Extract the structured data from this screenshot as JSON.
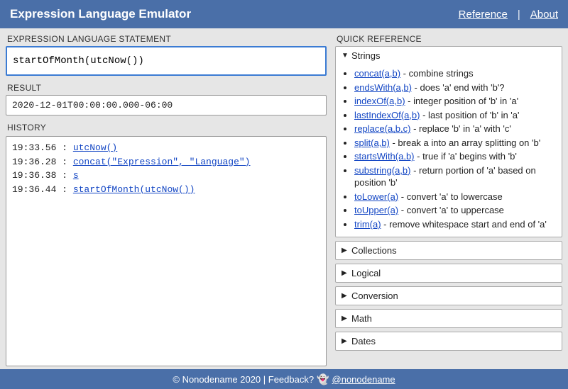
{
  "header": {
    "title": "Expression Language Emulator",
    "reference": "Reference",
    "about": "About"
  },
  "labels": {
    "statement": "EXPRESSION LANGUAGE STATEMENT",
    "result": "RESULT",
    "history": "HISTORY",
    "quickref": "QUICK REFERENCE"
  },
  "statement_value": "startOfMonth(utcNow())",
  "result_value": "2020-12-01T00:00:00.000-06:00",
  "history": [
    {
      "time": "19:33.56",
      "expr": "utcNow()"
    },
    {
      "time": "19:36.28",
      "expr": "concat(\"Expression\", \"Language\")"
    },
    {
      "time": "19:36.38",
      "expr": "s"
    },
    {
      "time": "19:36.44",
      "expr": "startOfMonth(utcNow())"
    }
  ],
  "quickref": {
    "sections": [
      {
        "title": "Strings",
        "open": true,
        "items": [
          {
            "fn": "concat(a,b)",
            "desc": "combine strings"
          },
          {
            "fn": "endsWith(a,b)",
            "desc": "does 'a' end with 'b'?"
          },
          {
            "fn": "indexOf(a,b)",
            "desc": "integer position of 'b' in 'a'"
          },
          {
            "fn": "lastIndexOf(a,b)",
            "desc": "last position of 'b' in 'a'"
          },
          {
            "fn": "replace(a,b,c)",
            "desc": "replace 'b' in 'a' with 'c'"
          },
          {
            "fn": "split(a,b)",
            "desc": "break a into an array splitting on 'b'"
          },
          {
            "fn": "startsWith(a,b)",
            "desc": "true if 'a' begins with 'b'"
          },
          {
            "fn": "substring(a,b)",
            "desc": "return portion of 'a' based on position 'b'"
          },
          {
            "fn": "toLower(a)",
            "desc": "convert 'a' to lowercase"
          },
          {
            "fn": "toUpper(a)",
            "desc": "convert 'a' to uppercase"
          },
          {
            "fn": "trim(a)",
            "desc": "remove whitespace start and end of 'a'"
          }
        ]
      },
      {
        "title": "Collections",
        "open": false,
        "items": []
      },
      {
        "title": "Logical",
        "open": false,
        "items": []
      },
      {
        "title": "Conversion",
        "open": false,
        "items": []
      },
      {
        "title": "Math",
        "open": false,
        "items": []
      },
      {
        "title": "Dates",
        "open": false,
        "items": []
      }
    ]
  },
  "footer": {
    "copyright": "© Nonodename 2020 | Feedback?",
    "handle": "@nonodename"
  }
}
